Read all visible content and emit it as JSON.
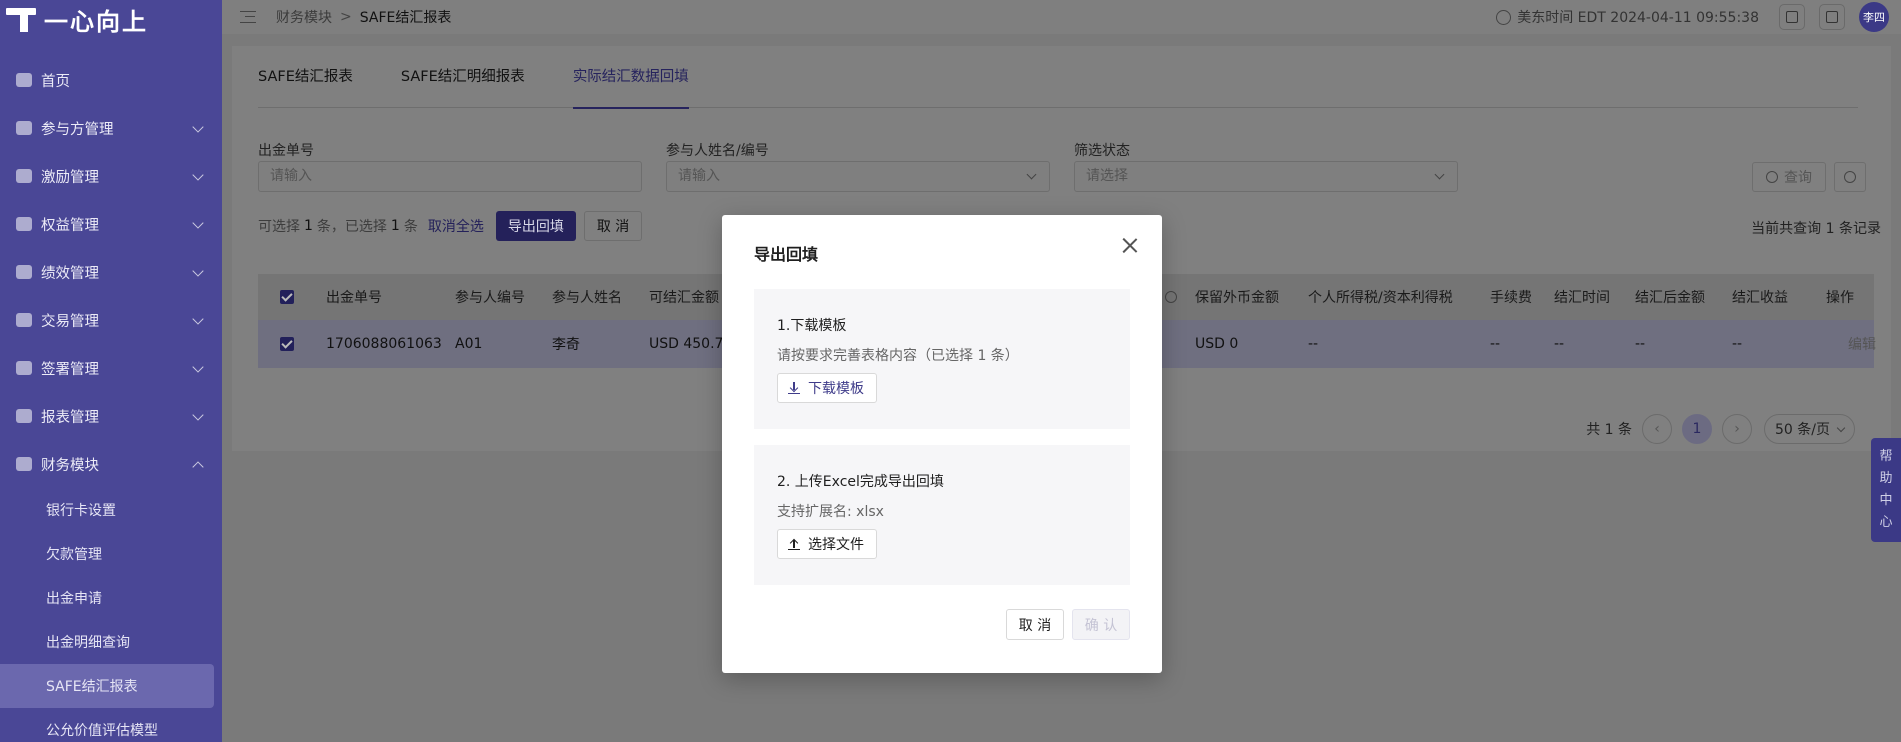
{
  "brand": {
    "name": "一心向上"
  },
  "sidebar": {
    "items": [
      {
        "label": "首页",
        "icon": "home-icon"
      },
      {
        "label": "参与方管理",
        "icon": "users-icon"
      },
      {
        "label": "激励管理",
        "icon": "incentive-icon"
      },
      {
        "label": "权益管理",
        "icon": "equity-icon"
      },
      {
        "label": "绩效管理",
        "icon": "performance-icon"
      },
      {
        "label": "交易管理",
        "icon": "trade-icon"
      },
      {
        "label": "签署管理",
        "icon": "sign-icon"
      },
      {
        "label": "报表管理",
        "icon": "report-icon"
      },
      {
        "label": "财务模块",
        "icon": "finance-icon"
      }
    ],
    "sub_items": [
      {
        "label": "银行卡设置"
      },
      {
        "label": "欠款管理"
      },
      {
        "label": "出金申请"
      },
      {
        "label": "出金明细查询"
      },
      {
        "label": "SAFE结汇报表"
      },
      {
        "label": "公允价值评估模型"
      }
    ]
  },
  "header": {
    "breadcrumb": [
      "财务模块",
      "SAFE结汇报表"
    ],
    "breadcrumb_sep": ">",
    "time_text": "美东时间 EDT 2024-04-11 09:55:38",
    "avatar": "李四"
  },
  "tabs": [
    {
      "label": "SAFE结汇报表"
    },
    {
      "label": "SAFE结汇明细报表"
    },
    {
      "label": "实际结汇数据回填"
    }
  ],
  "filters": {
    "order_label": "出金单号",
    "order_placeholder": "请输入",
    "participant_label": "参与人姓名/编号",
    "participant_placeholder": "请输入",
    "status_label": "筛选状态",
    "status_placeholder": "请选择",
    "query_label": "查询"
  },
  "selection": {
    "prefix": "可选择",
    "selectable": "1",
    "mid": "条，已选择",
    "selected": "1",
    "suffix": "条",
    "deselect_all": "取消全选",
    "export_fill": "导出回填",
    "cancel": "取 消"
  },
  "summary": {
    "prefix": "当前共查询",
    "count": "1",
    "suffix": "条记录"
  },
  "table": {
    "columns": [
      "出金单号",
      "参与人编号",
      "参与人姓名",
      "可结汇金额",
      "保留外币金额",
      "个人所得税/资本利得税",
      "手续费",
      "结汇时间",
      "结汇后金额",
      "结汇收益",
      "操作"
    ],
    "row": {
      "order_no": "1706088061063",
      "participant_no": "A01",
      "participant_name": "李奇",
      "amount": "USD 450.7",
      "reserved": "USD 0",
      "tax": "--",
      "fee": "--",
      "time": "--",
      "after": "--",
      "gain": "--",
      "action": "编辑"
    }
  },
  "pagination": {
    "total_text": "共 1 条",
    "current": "1",
    "page_size": "50 条/页"
  },
  "help": {
    "chars": [
      "帮",
      "助",
      "中",
      "心"
    ]
  },
  "modal": {
    "title": "导出回填",
    "step1_title": "1.下载模板",
    "step1_desc": "请按要求完善表格内容（已选择 1 条）",
    "step1_button": "下载模板",
    "step2_title": "2. 上传Excel完成导出回填",
    "step2_desc": "支持扩展名: xlsx",
    "step2_button": "选择文件",
    "cancel": "取 消",
    "confirm": "确 认"
  },
  "colors": {
    "sidebar": "#4a4796",
    "primary": "#3f3c8a",
    "overlay": "rgba(0,0,0,0.5)"
  }
}
